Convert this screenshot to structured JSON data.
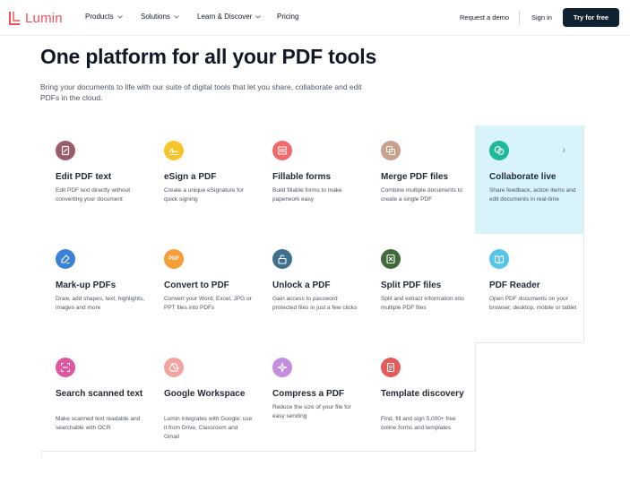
{
  "nav": {
    "brand": "Lumin",
    "items": [
      {
        "label": "Products"
      },
      {
        "label": "Solutions"
      },
      {
        "label": "Learn & Discover"
      },
      {
        "label": "Pricing"
      }
    ],
    "request_demo": "Request a demo",
    "sign_in": "Sign in",
    "cta": "Try for free"
  },
  "hero": {
    "title": "One platform for all your PDF tools",
    "subtitle": "Bring your documents to life with our suite of digital tools that let you share, collaborate and edit PDFs in the cloud."
  },
  "tools": [
    {
      "title": "Edit PDF text",
      "desc": "Edit PDF text directly without converting your document",
      "icon": "edit-document-icon",
      "color": "#9b5b6b"
    },
    {
      "title": "eSign a PDF",
      "desc": "Create a unique eSignature for quick signing",
      "icon": "signature-icon",
      "color": "#f7c52b"
    },
    {
      "title": "Fillable forms",
      "desc": "Build fillable forms to make paperwork easy",
      "icon": "form-icon",
      "color": "#ef6b6b"
    },
    {
      "title": "Merge PDF files",
      "desc": "Combine multiple documents to create a single PDF",
      "icon": "merge-icon",
      "color": "#c9a08a"
    },
    {
      "title": "Collaborate live",
      "desc": "Share feedback, action items and edit documents in real-time",
      "icon": "chat-bubbles-icon",
      "color": "#20b89a",
      "highlight": true,
      "arrow": "›"
    },
    {
      "title": "Mark-up PDFs",
      "desc": "Draw, add shapes, text, highlights, images and more",
      "icon": "markup-icon",
      "color": "#3b82d6"
    },
    {
      "title": "Convert to PDF",
      "desc": "Convert your Word, Excel, JPG or PPT files into PDFs",
      "icon": "pdf-badge-icon",
      "color": "#f59e3a",
      "badge": "PDF"
    },
    {
      "title": "Unlock a PDF",
      "desc": "Gain access to password protected files in just a few clicks",
      "icon": "unlock-icon",
      "color": "#3f6f8a"
    },
    {
      "title": "Split PDF files",
      "desc": "Split and extract information into multiple PDF files",
      "icon": "split-icon",
      "color": "#3f6b3a"
    },
    {
      "title": "PDF Reader",
      "desc": "Open PDF documents on your browser, desktop, mobile or tablet",
      "icon": "book-icon",
      "color": "#56c6e8"
    },
    {
      "title": "Search scanned text",
      "desc": "Make scanned text readable and searchable with OCR",
      "icon": "scan-icon",
      "color": "#e0569f"
    },
    {
      "title": "Google Workspace",
      "desc": "Lumin integrates with Google: use it from Drive, Classroom and Gmail",
      "icon": "google-drive-icon",
      "color": "#f2a5a0"
    },
    {
      "title": "Compress a PDF",
      "desc": "Reduce the size of your file for easy sending",
      "icon": "compress-icon",
      "color": "#c38ee0"
    },
    {
      "title": "Template discovery",
      "desc": "Find, fill and sign 5,000+ free online forms and templates",
      "icon": "template-icon",
      "color": "#e55a5a"
    }
  ]
}
